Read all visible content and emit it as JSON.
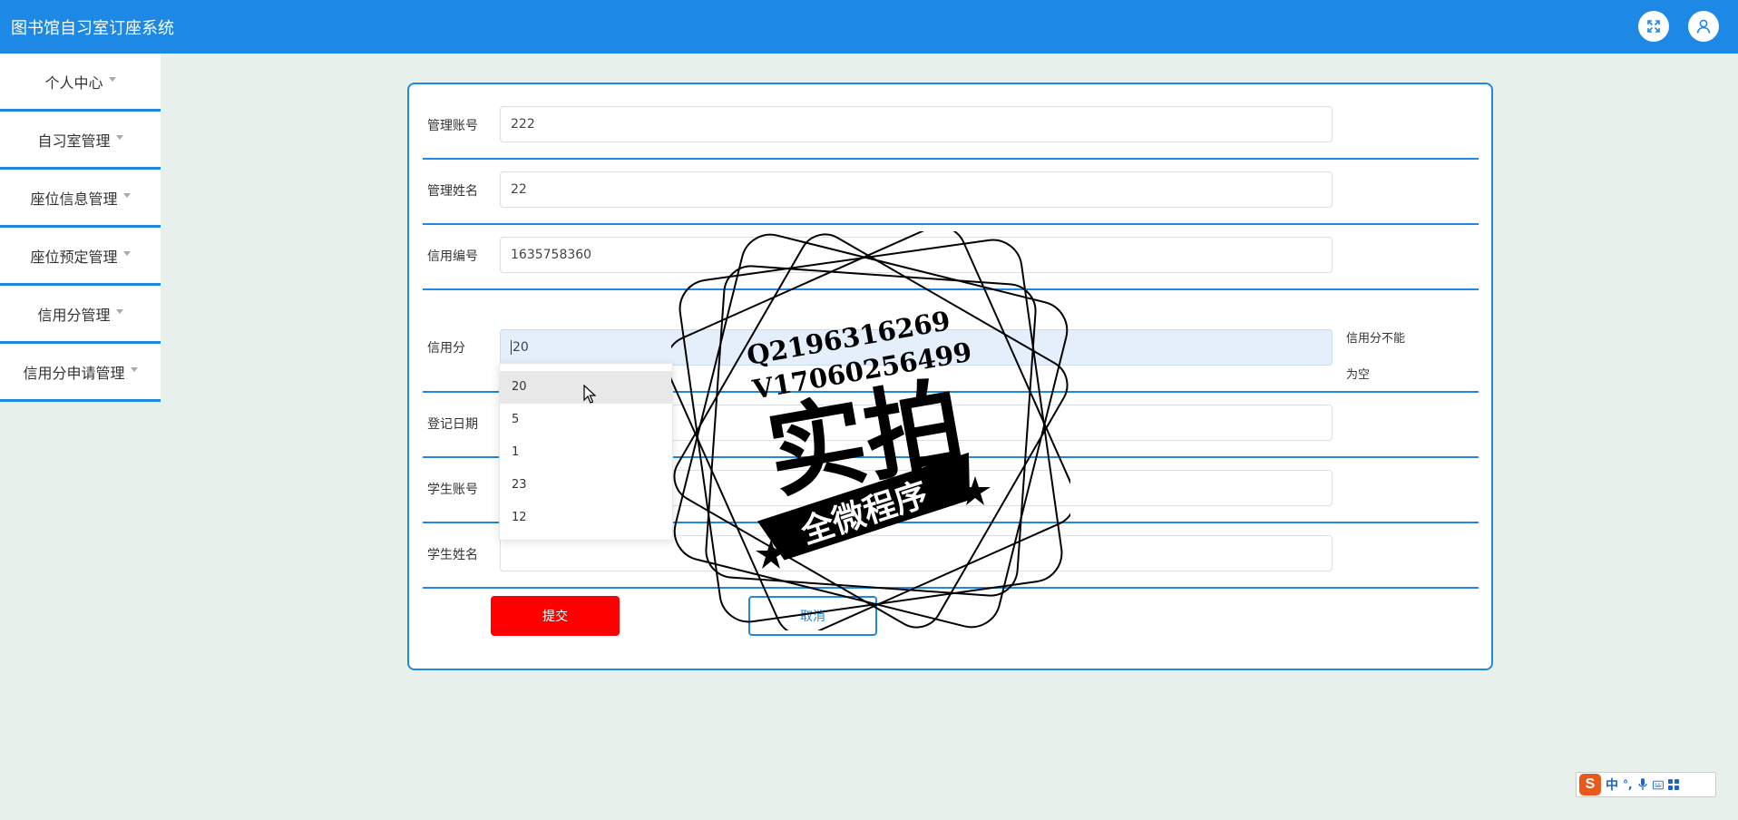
{
  "header": {
    "title": "图书馆自习室订座系统"
  },
  "sidebar": {
    "items": [
      {
        "label": "个人中心"
      },
      {
        "label": "自习室管理"
      },
      {
        "label": "座位信息管理"
      },
      {
        "label": "座位预定管理"
      },
      {
        "label": "信用分管理"
      },
      {
        "label": "信用分申请管理"
      }
    ]
  },
  "form": {
    "fields": [
      {
        "label": "管理账号",
        "value": "222"
      },
      {
        "label": "管理姓名",
        "value": "22"
      },
      {
        "label": "信用编号",
        "value": "1635758360"
      },
      {
        "label": "信用分",
        "value": "20",
        "error_line1": "信用分不能",
        "error_line2": "为空"
      },
      {
        "label": "登记日期",
        "value": ""
      },
      {
        "label": "学生账号",
        "value": ""
      },
      {
        "label": "学生姓名",
        "value": ""
      }
    ],
    "dropdown_options": [
      "20",
      "5",
      "1",
      "23",
      "12"
    ],
    "submit_label": "提交",
    "cancel_label": "取消"
  },
  "watermark": {
    "line1": "Q2196316269",
    "line2": "V17060256499",
    "big_text": "实拍",
    "banner_text": "全微程序"
  },
  "ime": {
    "logo": "S",
    "mode": "中",
    "punct": "°,"
  },
  "colors": {
    "primary": "#1e88e5",
    "submit": "#ff0000",
    "background": "#e8f0ec"
  }
}
